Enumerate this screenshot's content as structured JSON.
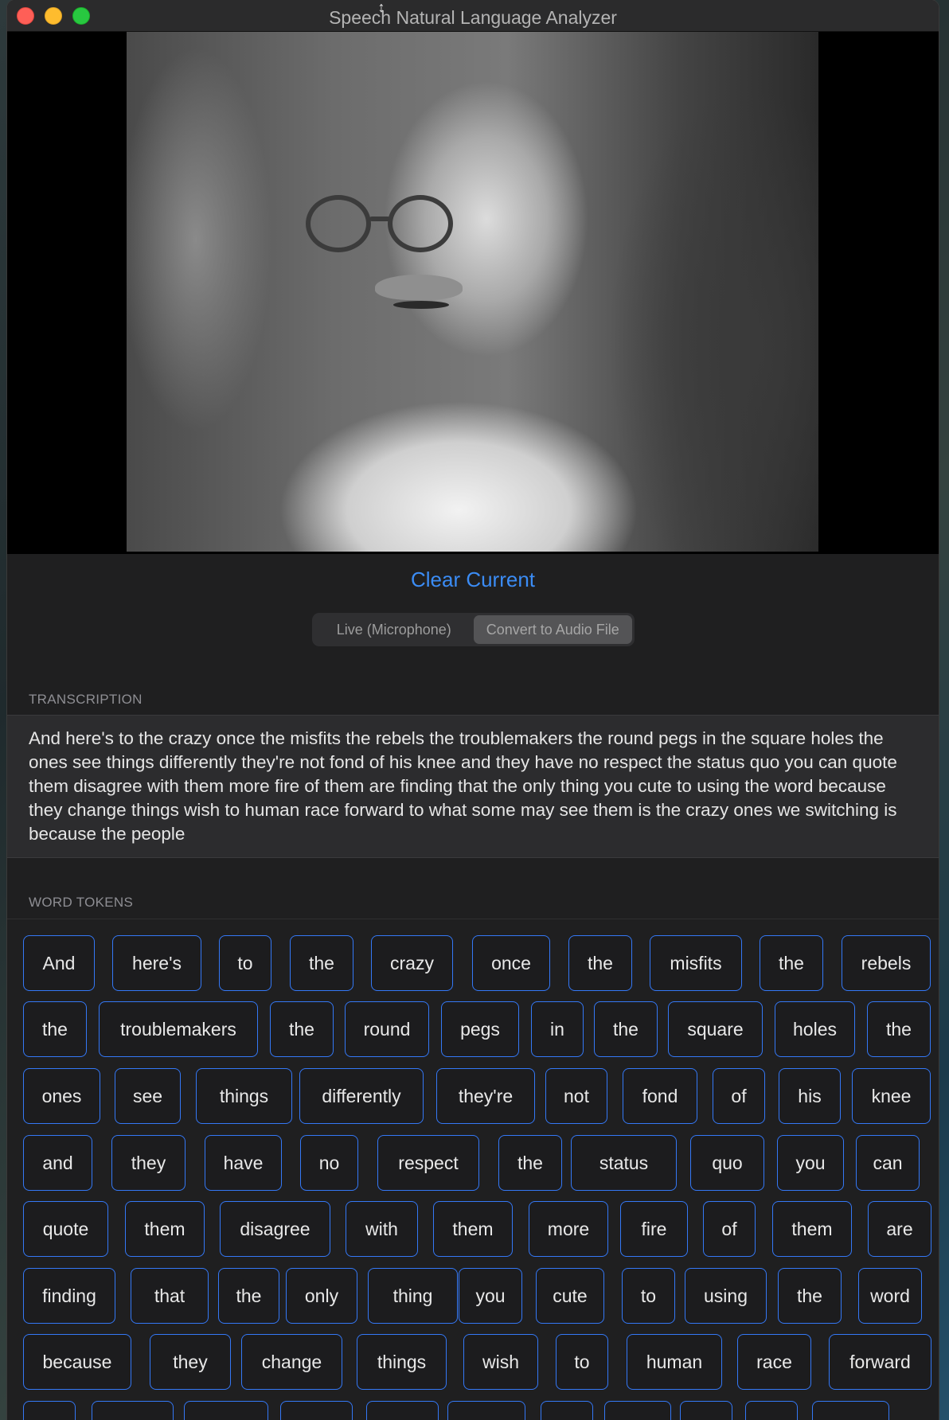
{
  "window": {
    "title": "Speech Natural Language Analyzer"
  },
  "controls": {
    "clear_label": "Clear Current",
    "modes": [
      {
        "label": "Live (Microphone)",
        "selected": false
      },
      {
        "label": "Convert to Audio File",
        "selected": true
      }
    ]
  },
  "transcription": {
    "heading": "TRANSCRIPTION",
    "text": "And here's to the crazy once the misfits the rebels the troublemakers the round pegs in the square holes the ones see things differently they're not fond of his knee and they have no respect the status quo you can quote them disagree with them more fire of them are finding that the only thing you cute to using the word because they change things wish to human race forward to what some may see them is the crazy ones we switching is because the people"
  },
  "tokens": {
    "heading": "WORD TOKENS",
    "rows": [
      [
        "And",
        "here's",
        "to",
        "the",
        "crazy",
        "once",
        "the",
        "misfits",
        "the",
        "rebels"
      ],
      [
        "the",
        "troublemakers",
        "the",
        "round",
        "pegs",
        "in",
        "the",
        "square",
        "holes",
        "the"
      ],
      [
        "ones",
        "see",
        "things",
        "differently",
        "they're",
        "not",
        "fond",
        "of",
        "his",
        "knee"
      ],
      [
        "and",
        "they",
        "have",
        "no",
        "respect",
        "the",
        "status",
        "quo",
        "you",
        "can"
      ],
      [
        "quote",
        "them",
        "disagree",
        "with",
        "them",
        "more",
        "fire",
        "of",
        "them",
        "are"
      ],
      [
        "finding",
        "that",
        "the",
        "only",
        "thing",
        "you",
        "cute",
        "to",
        "using",
        "the",
        "word"
      ],
      [
        "because",
        "they",
        "change",
        "things",
        "wish",
        "to",
        "human",
        "race",
        "forward"
      ]
    ]
  },
  "colors": {
    "accent": "#3478f6",
    "link": "#3b8cf5",
    "window_bg": "#1f1f20"
  }
}
